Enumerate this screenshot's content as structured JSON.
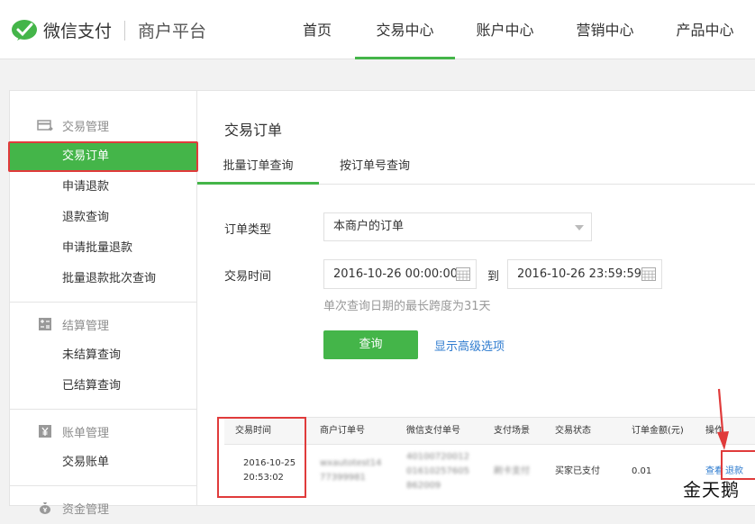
{
  "header": {
    "brand": "微信支付",
    "platform": "商户平台",
    "nav": [
      "首页",
      "交易中心",
      "账户中心",
      "营销中心",
      "产品中心"
    ],
    "active_nav": "交易中心"
  },
  "sidebar": {
    "groups": [
      {
        "title": "交易管理",
        "icon": "card-icon",
        "items": [
          "交易订单",
          "申请退款",
          "退款查询",
          "申请批量退款",
          "批量退款批次查询"
        ]
      },
      {
        "title": "结算管理",
        "icon": "calculator-icon",
        "items": [
          "未结算查询",
          "已结算查询"
        ]
      },
      {
        "title": "账单管理",
        "icon": "yen-icon",
        "items": [
          "交易账单"
        ]
      },
      {
        "title": "资金管理",
        "icon": "money-bag-icon",
        "items": []
      }
    ],
    "active_item": "交易订单"
  },
  "main": {
    "title": "交易订单",
    "tabs": [
      "批量订单查询",
      "按订单号查询"
    ],
    "form": {
      "order_type_label": "订单类型",
      "order_type_value": "本商户的订单",
      "time_label": "交易时间",
      "start": "2016-10-26 00:00:00",
      "to": "到",
      "end": "2016-10-26 23:59:59",
      "hint": "单次查询日期的最长跨度为31天",
      "query_button": "查询",
      "advanced_link": "显示高级选项"
    },
    "table": {
      "headers": [
        "交易时间",
        "商户订单号",
        "微信支付单号",
        "支付场景",
        "交易状态",
        "订单金额(元)",
        "操作"
      ],
      "row": {
        "time_date": "2016-10-25",
        "time_clock": "20:53:02",
        "merchant_no_1": "wxautotest14",
        "merchant_no_2": "77399981",
        "wx_no_1": "40100720012",
        "wx_no_2": "01610257605",
        "wx_no_3": "862009",
        "scene": "刷卡支付",
        "status": "买家已支付",
        "amount": "0.01",
        "action_view": "查看",
        "action_refund": "退款"
      }
    }
  },
  "watermark": "金天鹅",
  "colors": {
    "accent": "#44b549",
    "highlight": "#e03b3b",
    "link": "#2e7bcf"
  }
}
